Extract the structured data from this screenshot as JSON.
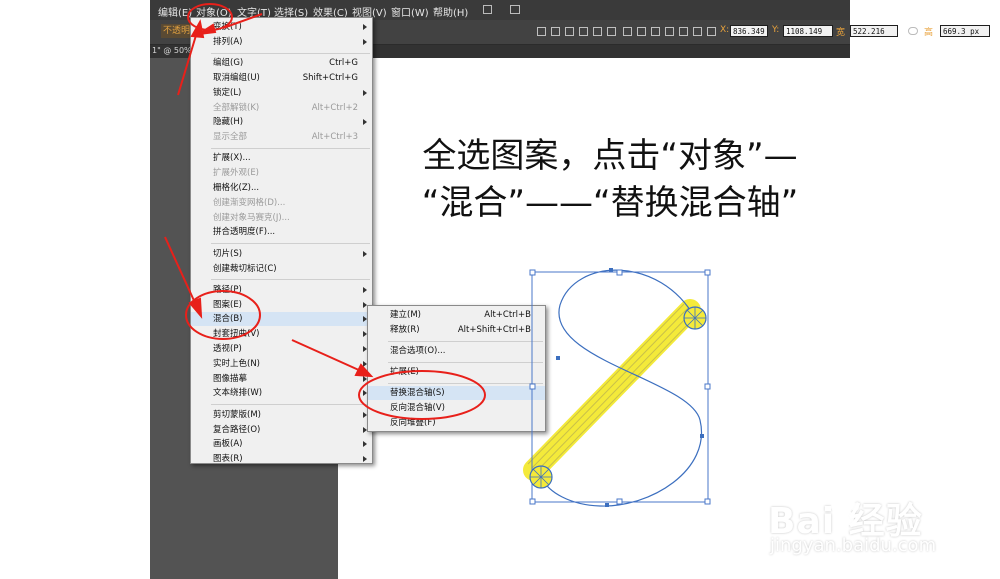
{
  "menubar": {
    "items": [
      "编辑(E)",
      "对象(O)",
      "文字(T)",
      "选择(S)",
      "效果(C)",
      "视图(V)",
      "窗口(W)",
      "帮助(H)"
    ]
  },
  "controlbar": {
    "opacity_label": "不透明",
    "x_value": "836.349",
    "y_value": "1108.149",
    "w_label": "宽",
    "w_value": "522.216",
    "h_label": "高",
    "h_value": "669.3 px"
  },
  "tab": {
    "label": "1\" @ 50%"
  },
  "object_menu": {
    "items": [
      {
        "label": "变换(T)",
        "shortcut": "",
        "submenu": true,
        "disabled": false
      },
      {
        "label": "排列(A)",
        "shortcut": "",
        "submenu": true,
        "disabled": false
      },
      {
        "sep": true
      },
      {
        "label": "编组(G)",
        "shortcut": "Ctrl+G",
        "submenu": false,
        "disabled": false
      },
      {
        "label": "取消编组(U)",
        "shortcut": "Shift+Ctrl+G",
        "submenu": false,
        "disabled": false
      },
      {
        "label": "锁定(L)",
        "shortcut": "",
        "submenu": true,
        "disabled": false
      },
      {
        "label": "全部解锁(K)",
        "shortcut": "Alt+Ctrl+2",
        "submenu": false,
        "disabled": true
      },
      {
        "label": "隐藏(H)",
        "shortcut": "",
        "submenu": true,
        "disabled": false
      },
      {
        "label": "显示全部",
        "shortcut": "Alt+Ctrl+3",
        "submenu": false,
        "disabled": true
      },
      {
        "sep": true
      },
      {
        "label": "扩展(X)...",
        "shortcut": "",
        "submenu": false,
        "disabled": false
      },
      {
        "label": "扩展外观(E)",
        "shortcut": "",
        "submenu": false,
        "disabled": true
      },
      {
        "label": "栅格化(Z)...",
        "shortcut": "",
        "submenu": false,
        "disabled": false
      },
      {
        "label": "创建渐变网格(D)...",
        "shortcut": "",
        "submenu": false,
        "disabled": true
      },
      {
        "label": "创建对象马赛克(J)...",
        "shortcut": "",
        "submenu": false,
        "disabled": true
      },
      {
        "label": "拼合透明度(F)...",
        "shortcut": "",
        "submenu": false,
        "disabled": false
      },
      {
        "sep": true
      },
      {
        "label": "切片(S)",
        "shortcut": "",
        "submenu": true,
        "disabled": false
      },
      {
        "label": "创建裁切标记(C)",
        "shortcut": "",
        "submenu": false,
        "disabled": false
      },
      {
        "sep": true
      },
      {
        "label": "路径(P)",
        "shortcut": "",
        "submenu": true,
        "disabled": false
      },
      {
        "label": "图案(E)",
        "shortcut": "",
        "submenu": true,
        "disabled": false
      },
      {
        "label": "混合(B)",
        "shortcut": "",
        "submenu": true,
        "disabled": false,
        "highlighted": true
      },
      {
        "label": "封套扭曲(V)",
        "shortcut": "",
        "submenu": true,
        "disabled": false
      },
      {
        "label": "透视(P)",
        "shortcut": "",
        "submenu": true,
        "disabled": false
      },
      {
        "label": "实时上色(N)",
        "shortcut": "",
        "submenu": true,
        "disabled": false
      },
      {
        "label": "图像描摹",
        "shortcut": "",
        "submenu": true,
        "disabled": false
      },
      {
        "label": "文本绕排(W)",
        "shortcut": "",
        "submenu": true,
        "disabled": false
      },
      {
        "sep": true
      },
      {
        "label": "剪切蒙版(M)",
        "shortcut": "",
        "submenu": true,
        "disabled": false
      },
      {
        "label": "复合路径(O)",
        "shortcut": "",
        "submenu": true,
        "disabled": false
      },
      {
        "label": "画板(A)",
        "shortcut": "",
        "submenu": true,
        "disabled": false
      },
      {
        "label": "图表(R)",
        "shortcut": "",
        "submenu": true,
        "disabled": false
      }
    ]
  },
  "blend_menu": {
    "items": [
      {
        "label": "建立(M)",
        "shortcut": "Alt+Ctrl+B"
      },
      {
        "label": "释放(R)",
        "shortcut": "Alt+Shift+Ctrl+B"
      },
      {
        "sep": true
      },
      {
        "label": "混合选项(O)...",
        "shortcut": ""
      },
      {
        "sep": true
      },
      {
        "label": "扩展(E)",
        "shortcut": ""
      },
      {
        "sep": true
      },
      {
        "label": "替换混合轴(S)",
        "shortcut": "",
        "highlighted": true
      },
      {
        "label": "反向混合轴(V)",
        "shortcut": ""
      },
      {
        "label": "反向堆叠(F)",
        "shortcut": ""
      }
    ]
  },
  "instruction": {
    "line1": "全选图案，点击“对象”—",
    "line2": "“混合”——“替换混合轴”"
  },
  "watermark": {
    "logo": "Bai  经验",
    "url": "jingyan.baidu.com"
  },
  "colors": {
    "annotation": "#e8201a",
    "path": "#3c6fbf",
    "blend": "#f4ea3a",
    "menu_highlight": "#d5e4f4"
  }
}
